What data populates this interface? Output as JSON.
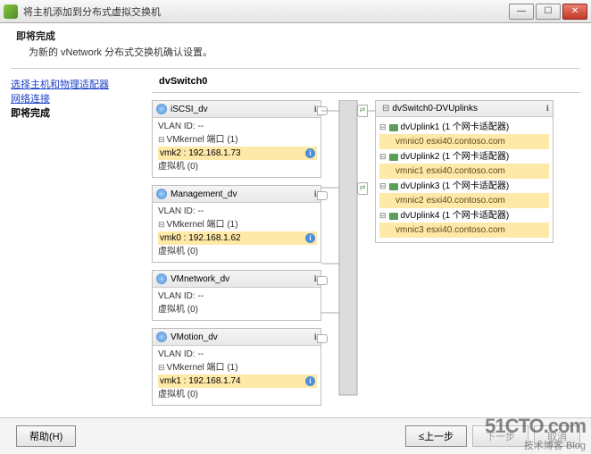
{
  "window": {
    "title": "将主机添加到分布式虚拟交换机"
  },
  "header": {
    "title": "即将完成",
    "subtitle": "为新的 vNetwork 分布式交换机确认设置。"
  },
  "nav": {
    "step1": "选择主机和物理适配器",
    "step2": "网络连接",
    "current": "即将完成"
  },
  "switch_name": "dvSwitch0",
  "portgroups": [
    {
      "name": "iSCSI_dv",
      "vlan": "VLAN ID: --",
      "vmk_label": "VMkernel 端口 (1)",
      "vmk": "vmk2 : 192.168.1.73",
      "vm": "虚拟机 (0)"
    },
    {
      "name": "Management_dv",
      "vlan": "VLAN ID: --",
      "vmk_label": "VMkernel 端口 (1)",
      "vmk": "vmk0 : 192.168.1.62",
      "vm": "虚拟机 (0)"
    },
    {
      "name": "VMnetwork_dv",
      "vlan": "VLAN ID: --",
      "vm": "虚拟机 (0)"
    },
    {
      "name": "VMotion_dv",
      "vlan": "VLAN ID: --",
      "vmk_label": "VMkernel 端口 (1)",
      "vmk": "vmk1 : 192.168.1.74",
      "vm": "虚拟机 (0)"
    }
  ],
  "uplinks": {
    "title": "dvSwitch0-DVUplinks",
    "items": [
      {
        "name": "dvUplink1 (1 个网卡适配器)",
        "nic": "vmnic0 esxi40.contoso.com"
      },
      {
        "name": "dvUplink2 (1 个网卡适配器)",
        "nic": "vmnic1 esxi40.contoso.com"
      },
      {
        "name": "dvUplink3 (1 个网卡适配器)",
        "nic": "vmnic2 esxi40.contoso.com"
      },
      {
        "name": "dvUplink4 (1 个网卡适配器)",
        "nic": "vmnic3 esxi40.contoso.com"
      }
    ]
  },
  "footer": {
    "help": "帮助(H)",
    "back": "≤上一步",
    "next": "下一步",
    "cancel": "取消"
  },
  "watermark": {
    "big": "51CTO.com",
    "small": "技术博客            Blog"
  }
}
